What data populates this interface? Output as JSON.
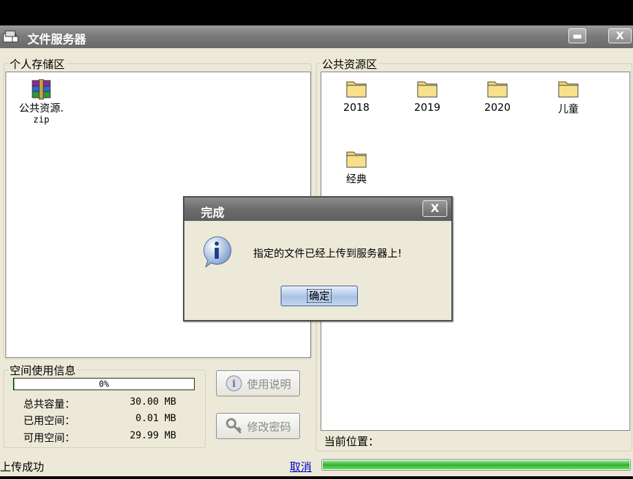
{
  "window": {
    "title": "文件服务器",
    "minimize_glyph": "▬",
    "close_glyph": "X"
  },
  "personal": {
    "legend": "个人存储区",
    "files": [
      {
        "name_line1": "公共资源.",
        "name_line2": "zip",
        "icon": "winrar-archive-icon"
      }
    ]
  },
  "public": {
    "legend": "公共资源区",
    "folders": [
      {
        "name": "2018",
        "icon": "folder-icon"
      },
      {
        "name": "2019",
        "icon": "folder-icon"
      },
      {
        "name": "2020",
        "icon": "folder-icon"
      },
      {
        "name": "儿童",
        "icon": "folder-icon"
      },
      {
        "name": "经典",
        "icon": "folder-icon"
      }
    ],
    "location_label": "当前位置："
  },
  "space": {
    "legend": "空间使用信息",
    "percent_text": "0%",
    "used_fraction": 0.0003,
    "rows": [
      {
        "label": "总共容量：",
        "value": "30.00 MB"
      },
      {
        "label": "已用空间：",
        "value": "0.01 MB"
      },
      {
        "label": "可用空间：",
        "value": "29.99 MB"
      }
    ]
  },
  "buttons": {
    "help": "使用说明",
    "change_password": "修改密码"
  },
  "status": {
    "text": "上传成功",
    "cancel": "取消",
    "progress_fraction": 1.0
  },
  "dialog": {
    "title": "完成",
    "close_glyph": "X",
    "message": "指定的文件已经上传到服务器上!",
    "ok": "确定"
  },
  "colors": {
    "progress_green": "#2db52d",
    "link_blue": "#0000c8"
  }
}
